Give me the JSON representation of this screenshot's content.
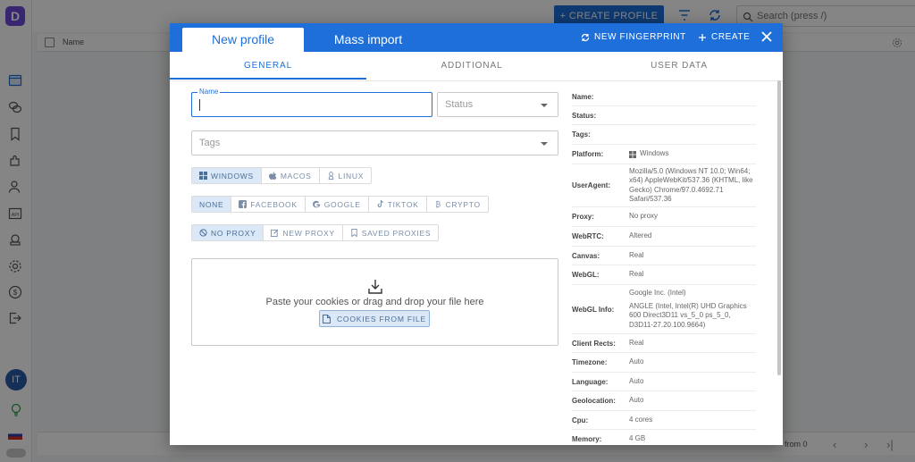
{
  "app": {
    "logo_letter": "D",
    "avatar_initials": "IT",
    "create_profile_label": "CREATE PROFILE",
    "search_placeholder": "Search (press /)",
    "column_name": "Name",
    "pagination_text": "from 0"
  },
  "modal": {
    "tab_new_profile": "New profile",
    "tab_mass_import": "Mass import",
    "new_fingerprint_label": "NEW FINGERPRINT",
    "create_label": "CREATE",
    "subtabs": [
      "GENERAL",
      "ADDITIONAL",
      "USER DATA"
    ],
    "name_label": "Name",
    "name_value": "",
    "status_placeholder": "Status",
    "tags_placeholder": "Tags",
    "os_options": [
      "WINDOWS",
      "MACOS",
      "LINUX"
    ],
    "os_selected": "WINDOWS",
    "template_options": [
      "NONE",
      "FACEBOOK",
      "GOOGLE",
      "TIKTOK",
      "CRYPTO"
    ],
    "template_selected": "NONE",
    "proxy_options": [
      "NO PROXY",
      "NEW PROXY",
      "SAVED PROXIES"
    ],
    "proxy_selected": "NO PROXY",
    "dropzone_text": "Paste your cookies or drag and drop your file here",
    "cookies_button_label": "COOKIES FROM FILE"
  },
  "summary": [
    {
      "key": "Name:",
      "value": ""
    },
    {
      "key": "Status:",
      "value": ""
    },
    {
      "key": "Tags:",
      "value": ""
    },
    {
      "key": "Platform:",
      "value": "Windows",
      "icon": "windows-icon"
    },
    {
      "key": "UserAgent:",
      "value": "Mozilla/5.0 (Windows NT 10.0; Win64; x64) AppleWebKit/537.36 (KHTML, like Gecko) Chrome/97.0.4692.71 Safari/537.36"
    },
    {
      "key": "Proxy:",
      "value": "No proxy"
    },
    {
      "key": "WebRTC:",
      "value": "Altered"
    },
    {
      "key": "Canvas:",
      "value": "Real"
    },
    {
      "key": "WebGL:",
      "value": "Real"
    },
    {
      "key": "WebGL Info:",
      "value": "Google Inc. (Intel)",
      "value2": "ANGLE (Intel, Intel(R) UHD Graphics 600 Direct3D11 vs_5_0 ps_5_0, D3D11-27.20.100.9664)"
    },
    {
      "key": "Client Rects:",
      "value": "Real"
    },
    {
      "key": "Timezone:",
      "value": "Auto"
    },
    {
      "key": "Language:",
      "value": "Auto"
    },
    {
      "key": "Geolocation:",
      "value": "Auto"
    },
    {
      "key": "Cpu:",
      "value": "4 cores"
    },
    {
      "key": "Memory:",
      "value": "4 GB"
    }
  ],
  "colors": {
    "accent": "#1e6fd9",
    "selected_segment_bg": "#dbe8f7",
    "logo": "#6b4bd6"
  }
}
